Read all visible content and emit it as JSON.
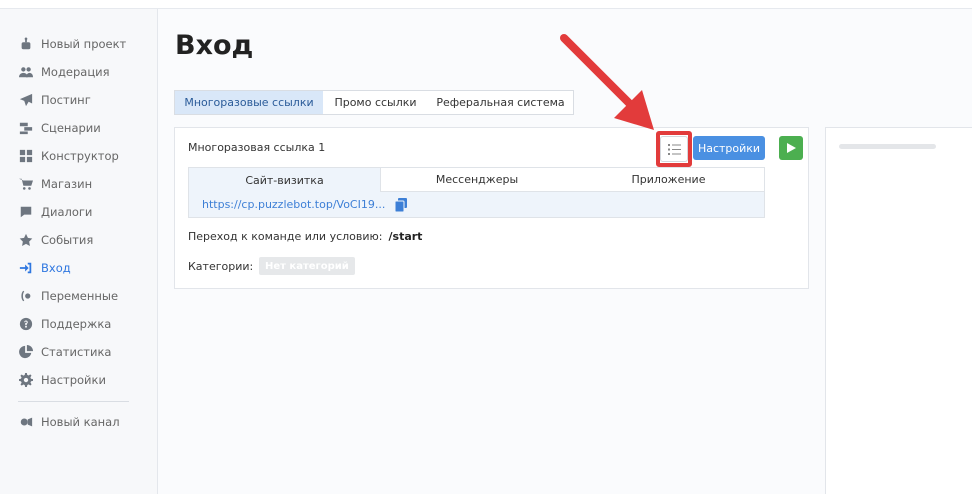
{
  "sidebar": {
    "items": [
      {
        "label": "Новый проект",
        "icon": "bot-icon"
      },
      {
        "label": "Модерация",
        "icon": "users-icon"
      },
      {
        "label": "Постинг",
        "icon": "paper-plane-icon"
      },
      {
        "label": "Сценарии",
        "icon": "scenario-icon"
      },
      {
        "label": "Конструктор",
        "icon": "grid-icon"
      },
      {
        "label": "Магазин",
        "icon": "cart-icon"
      },
      {
        "label": "Диалоги",
        "icon": "chat-icon"
      },
      {
        "label": "События",
        "icon": "star-icon"
      },
      {
        "label": "Вход",
        "icon": "sign-in-icon"
      },
      {
        "label": "Переменные",
        "icon": "variable-icon"
      },
      {
        "label": "Поддержка",
        "icon": "help-icon"
      },
      {
        "label": "Статистика",
        "icon": "pie-chart-icon"
      },
      {
        "label": "Настройки",
        "icon": "gear-icon"
      }
    ],
    "channel": {
      "label": "Новый канал",
      "icon": "channel-icon"
    }
  },
  "page": {
    "title": "Вход"
  },
  "tabs": [
    {
      "label": "Многоразовые ссылки"
    },
    {
      "label": "Промо ссылки"
    },
    {
      "label": "Реферальная система"
    }
  ],
  "card": {
    "link_name": "Многоразовая ссылка 1",
    "settings_label": "Настройки",
    "inner_tabs": [
      {
        "label": "Сайт-визитка"
      },
      {
        "label": "Мессенджеры"
      },
      {
        "label": "Приложение"
      }
    ],
    "url": "https://cp.puzzlebot.top/VoCI19...",
    "transition_label": "Переход к команде или условию:",
    "transition_command": "/start",
    "categories_label": "Категории:",
    "categories_value": "Нет категорий"
  },
  "colors": {
    "accent": "#4a90e2",
    "play": "#4caf50",
    "annotation": "#e23b3b",
    "active_tab": "#d9e7f8"
  }
}
